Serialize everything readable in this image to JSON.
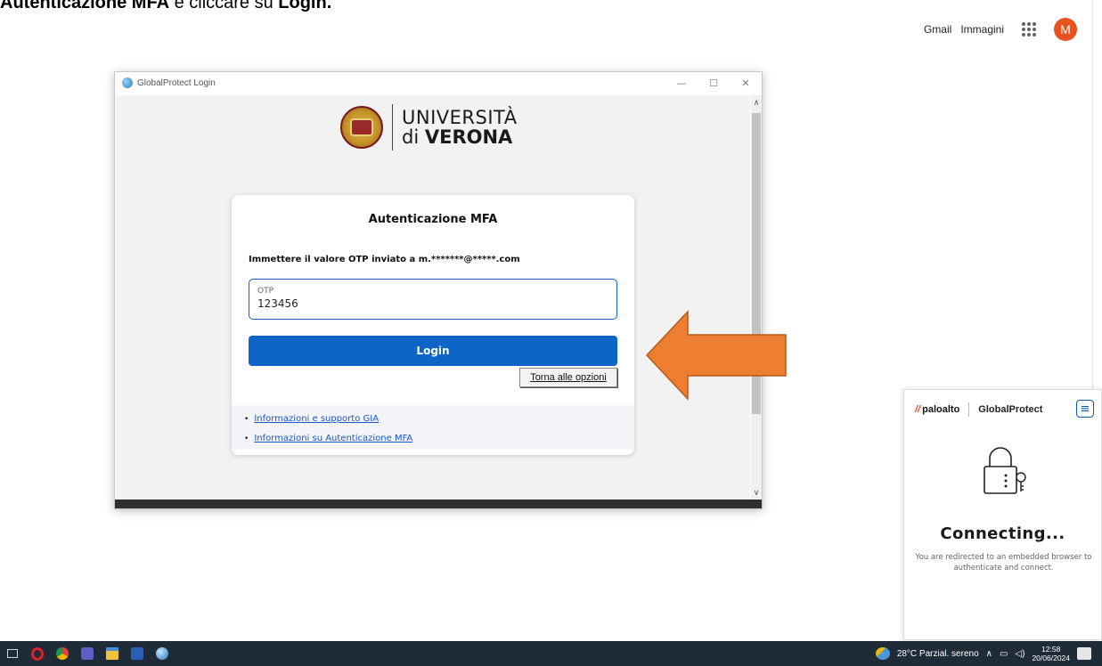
{
  "caption": {
    "bold1": "Autenticazione MFA",
    "middle": " e cliccare su ",
    "bold2": "Login."
  },
  "google_bar": {
    "gmail": "Gmail",
    "images": "Immagini",
    "avatar_letter": "M",
    "avatar_color": "#e8521e"
  },
  "login_window": {
    "title": "GlobalProtect Login",
    "controls": {
      "minimize": "—",
      "maximize": "☐",
      "close": "✕"
    },
    "logo": {
      "line1": "UNIVERSITÀ",
      "line2_prefix": "di ",
      "line2_bold": "VERONA"
    },
    "card": {
      "title": "Autenticazione MFA",
      "message": "Immettere il valore OTP inviato a m.*******@*****.com",
      "otp_label": "OTP",
      "otp_value": "123456",
      "login_label": "Login",
      "back_label": "Torna alle opzioni",
      "links": [
        "Informazioni e supporto GIA",
        "Informazioni su Autenticazione MFA"
      ]
    }
  },
  "arrow": {
    "color": "#ed7d31"
  },
  "globalprotect_panel": {
    "brand": "paloalto",
    "product": "GlobalProtect",
    "status": "Connecting...",
    "description": "You are redirected to an embedded browser to authenticate and connect."
  },
  "taskbar": {
    "weather": "28°C Parzial. sereno",
    "time": "12:58",
    "date": "20/06/2024",
    "bg_color": "#1f2c38"
  }
}
